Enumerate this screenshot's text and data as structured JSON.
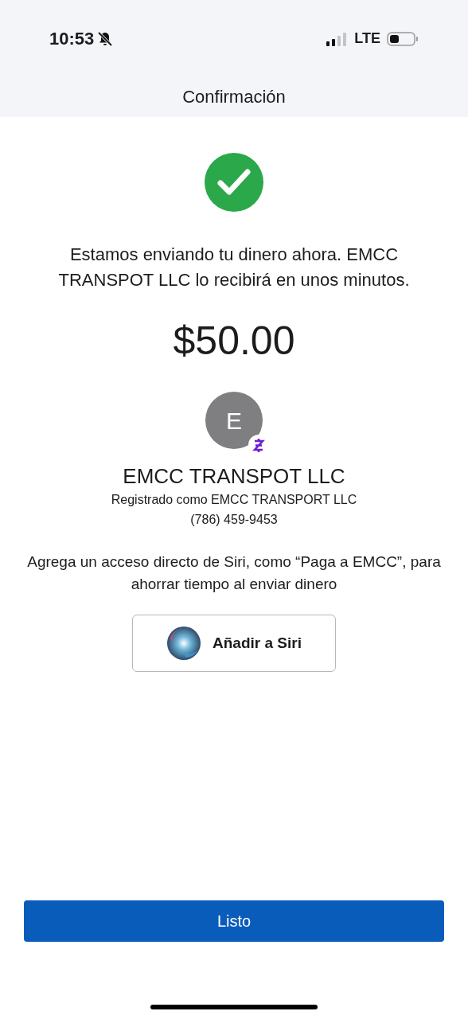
{
  "status_bar": {
    "time": "10:53",
    "network": "LTE"
  },
  "nav": {
    "title": "Confirmación"
  },
  "message": "Estamos enviando tu dinero ahora. EMCC TRANSPOT LLC lo recibirá en unos minutos.",
  "amount": "$50.00",
  "recipient": {
    "initial": "E",
    "name": "EMCC TRANSPOT LLC",
    "registered": "Registrado como EMCC TRANSPORT LLC",
    "phone": "(786) 459-9453"
  },
  "siri": {
    "text": "Agrega un acceso directo de Siri, como “Paga a EMCC”, para ahorrar tiempo al enviar dinero",
    "button": "Añadir a Siri"
  },
  "done_button": "Listo"
}
